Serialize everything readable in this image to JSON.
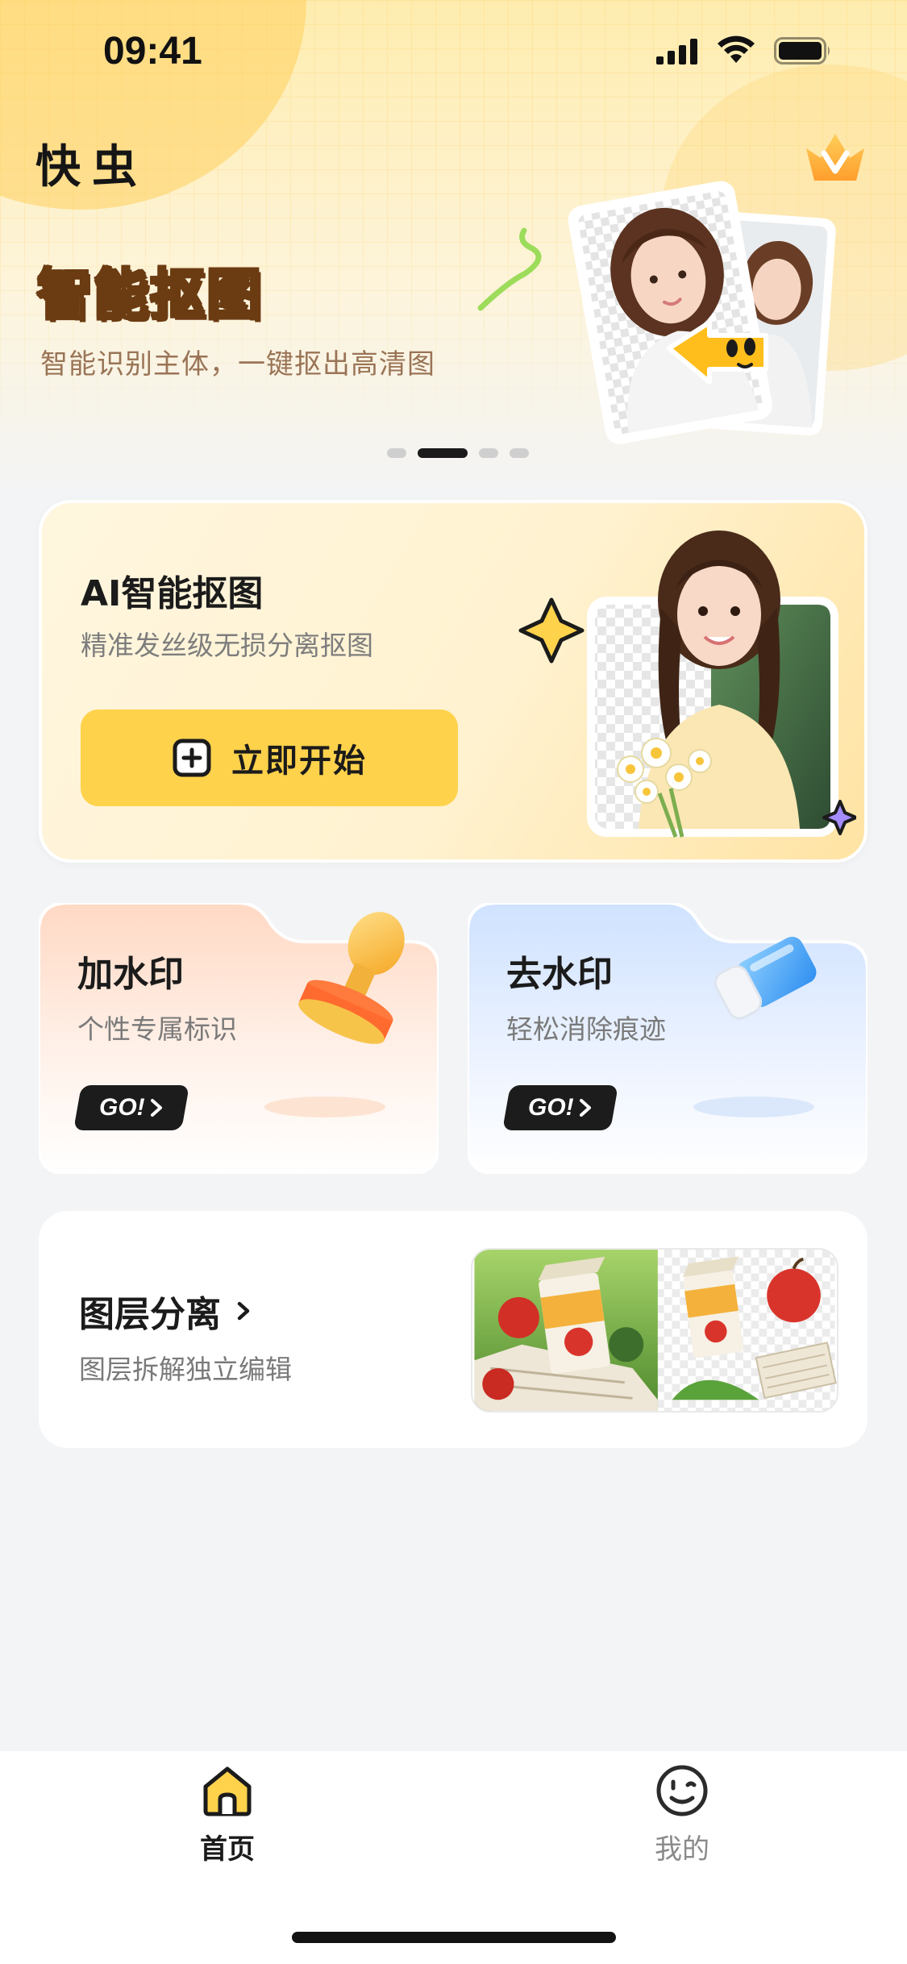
{
  "status_bar": {
    "time": "09:41"
  },
  "header": {
    "app_title": "快虫",
    "vip_icon": "crown-v-icon"
  },
  "banner": {
    "title": "智能抠图",
    "subtitle": "智能识别主体，一键抠出高清图",
    "dots_count": 4,
    "active_dot": 1
  },
  "ai_card": {
    "title": "AI智能抠图",
    "subtitle": "精准发丝级无损分离抠图",
    "button_label": "立即开始",
    "button_icon": "plus-square-icon"
  },
  "features": [
    {
      "id": "watermark-add",
      "title": "加水印",
      "subtitle": "个性专属标识",
      "go_label": "GO!",
      "icon": "stamp-icon"
    },
    {
      "id": "watermark-remove",
      "title": "去水印",
      "subtitle": "轻松消除痕迹",
      "go_label": "GO!",
      "icon": "eraser-icon"
    }
  ],
  "layer_card": {
    "title": "图层分离",
    "subtitle": "图层拆解独立编辑"
  },
  "tab_bar": {
    "tabs": [
      {
        "label": "首页",
        "icon": "home-icon",
        "active": true
      },
      {
        "label": "我的",
        "icon": "smiley-face-icon",
        "active": false
      }
    ]
  },
  "colors": {
    "accent_yellow": "#ffd24c",
    "dark": "#1b1b1b",
    "muted_text": "#7a7a7a",
    "background": "#f3f4f6"
  }
}
